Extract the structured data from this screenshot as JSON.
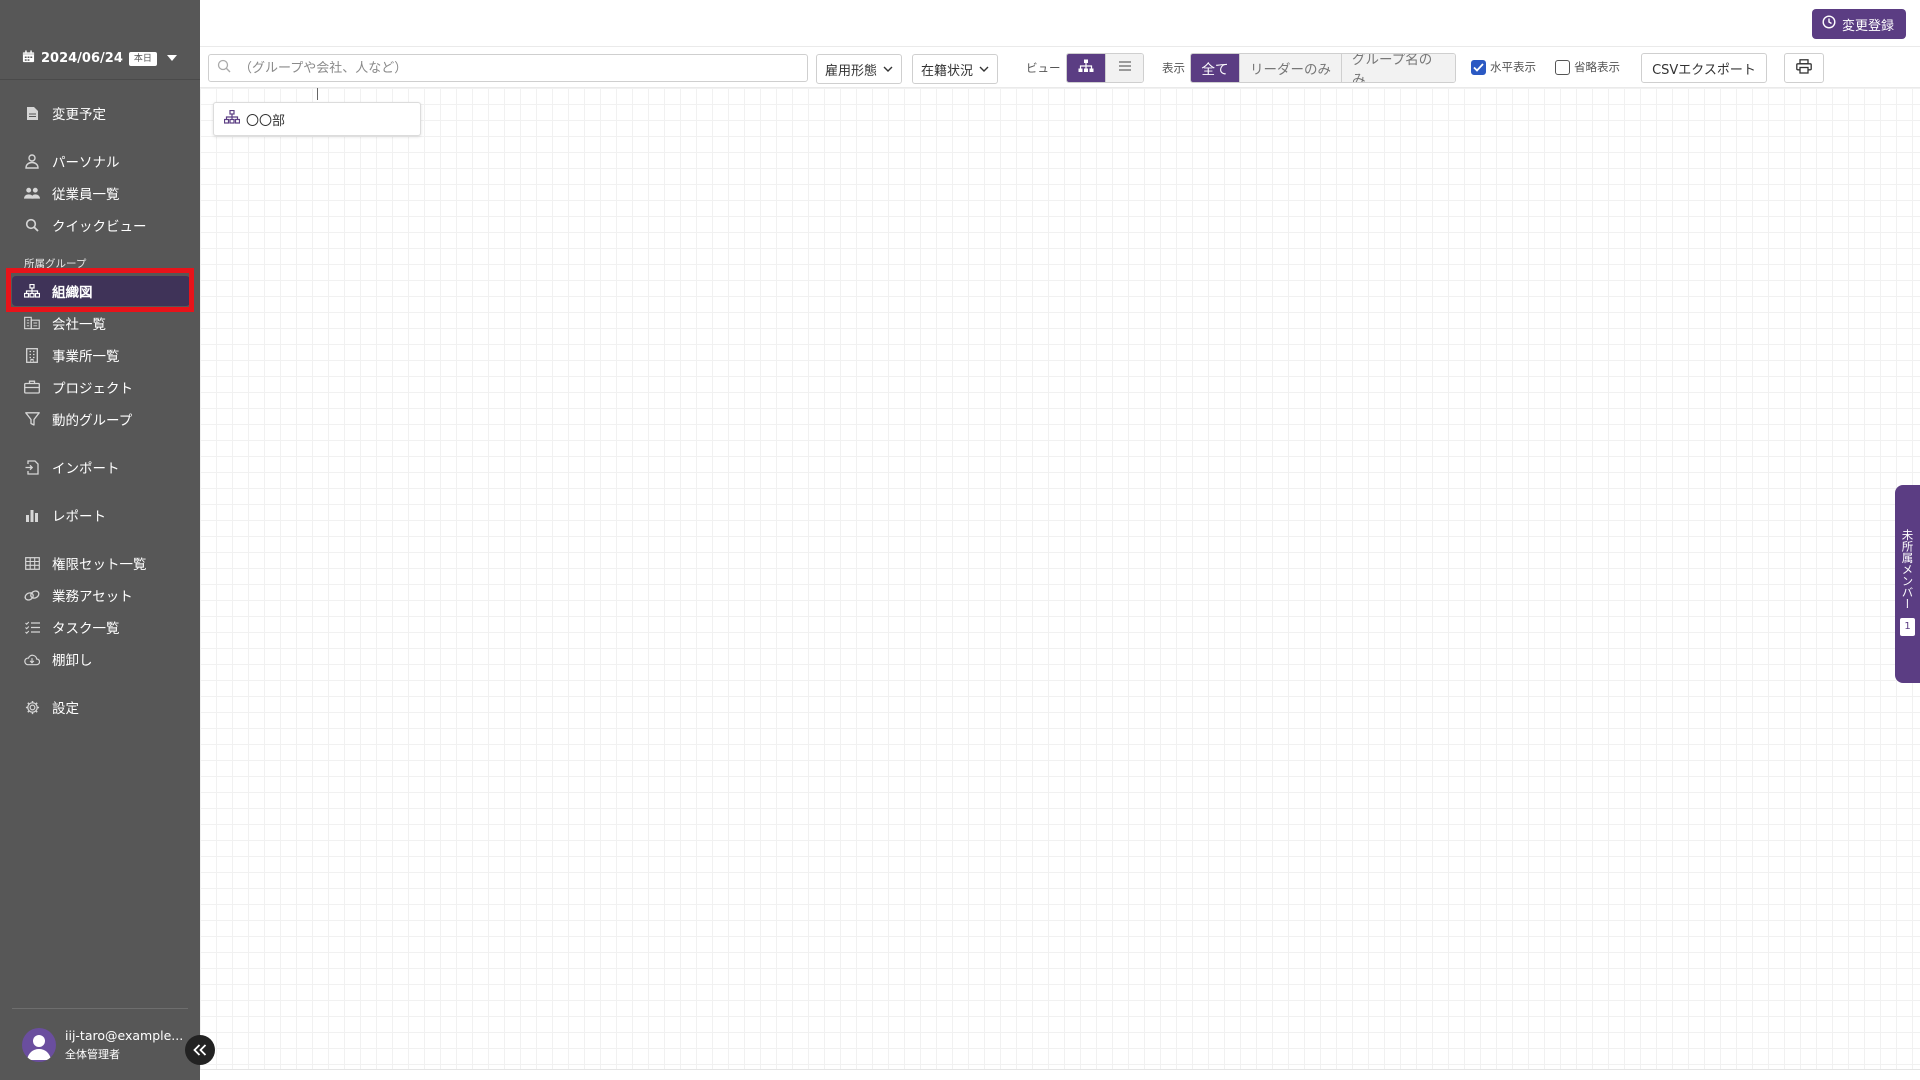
{
  "sidebar": {
    "date": "2024/06/24",
    "today_badge": "本日",
    "items": [
      {
        "label": "変更予定",
        "icon": "file-icon"
      },
      {
        "label": "パーソナル",
        "icon": "user-icon"
      },
      {
        "label": "従業員一覧",
        "icon": "users-icon"
      },
      {
        "label": "クイックビュー",
        "icon": "search-icon"
      },
      {
        "label": "組織図",
        "icon": "org-chart-icon"
      },
      {
        "label": "会社一覧",
        "icon": "building-list-icon"
      },
      {
        "label": "事業所一覧",
        "icon": "office-icon"
      },
      {
        "label": "プロジェクト",
        "icon": "briefcase-icon"
      },
      {
        "label": "動的グループ",
        "icon": "filter-icon"
      },
      {
        "label": "インポート",
        "icon": "import-icon"
      },
      {
        "label": "レポート",
        "icon": "bar-chart-icon"
      },
      {
        "label": "権限セット一覧",
        "icon": "table-icon"
      },
      {
        "label": "業務アセット",
        "icon": "link-icon"
      },
      {
        "label": "タスク一覧",
        "icon": "task-list-icon"
      },
      {
        "label": "棚卸し",
        "icon": "cloud-icon"
      },
      {
        "label": "設定",
        "icon": "gear-icon"
      }
    ],
    "section_label": "所属グループ",
    "active_item": "組織図",
    "user": {
      "email": "iij-taro@example...",
      "role": "全体管理者"
    }
  },
  "header": {
    "change_button_label": "変更登録"
  },
  "toolbar": {
    "search_placeholder": "（グループや会社、人など）",
    "employment_type_label": "雇用形態",
    "status_label": "在籍状況",
    "view_label": "ビュー",
    "display_label": "表示",
    "display_options": [
      "全て",
      "リーダーのみ",
      "グループ名のみ"
    ],
    "display_selected": "全て",
    "horizontal_label": "水平表示",
    "horizontal_checked": true,
    "abbrev_label": "省略表示",
    "abbrev_checked": false,
    "csv_export_label": "CSVエクスポート"
  },
  "org_chart": {
    "nodes": [
      {
        "label": "〇〇部"
      }
    ]
  },
  "unassigned_tab": {
    "label": "未所属メンバー",
    "count": "1"
  },
  "colors": {
    "accent": "#5b3d83",
    "sidebar_bg": "#575757",
    "highlight": "#e8131a"
  }
}
